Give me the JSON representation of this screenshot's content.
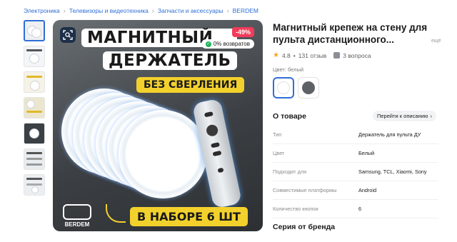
{
  "breadcrumb": [
    "Электроника",
    "Телевизоры и видеотехника",
    "Запчасти и аксессуары",
    "BERDEM"
  ],
  "gallery": {
    "thumb_count": 7,
    "banner": {
      "line1": "МАГНИТНЫЙ",
      "line2": "ДЕРЖАТЕЛЬ",
      "chip_top": "БЕЗ СВЕРЛЕНИЯ",
      "chip_bottom": "В НАБОРЕ 6 ШТ",
      "brand": "BERDEM"
    },
    "discount": "-49%",
    "returns": "0% возвратов",
    "returns_check": "✓"
  },
  "product": {
    "title": "Магнитный крепеж на стену для пульта дистанционного...",
    "share": "ещё",
    "rating": "4.8",
    "reviews": "131 отзыв",
    "questions": "3 вопроса",
    "color_label": "Цвет: белый",
    "swatches": [
      {
        "name": "белый",
        "color": "#ffffff"
      },
      {
        "name": "серый",
        "color": "#5e6266"
      }
    ]
  },
  "about": {
    "title": "О товаре",
    "to_description": "Перейти к описанию",
    "attributes": [
      {
        "key": "Тип",
        "value": "Держатель для пульта ДУ"
      },
      {
        "key": "Цвет",
        "value": "Белый"
      },
      {
        "key": "Подходит для",
        "value": "Samsung, TCL, Xiaomi, Sony"
      },
      {
        "key": "Совместимые платформы",
        "value": "Android"
      },
      {
        "key": "Количество кнопок",
        "value": "6"
      }
    ]
  },
  "series_title": "Серия от бренда",
  "colors": {
    "accent": "#2f6fd6",
    "star": "#f5a623",
    "discount": "#f23b5a",
    "chip": "#f3d12c"
  }
}
